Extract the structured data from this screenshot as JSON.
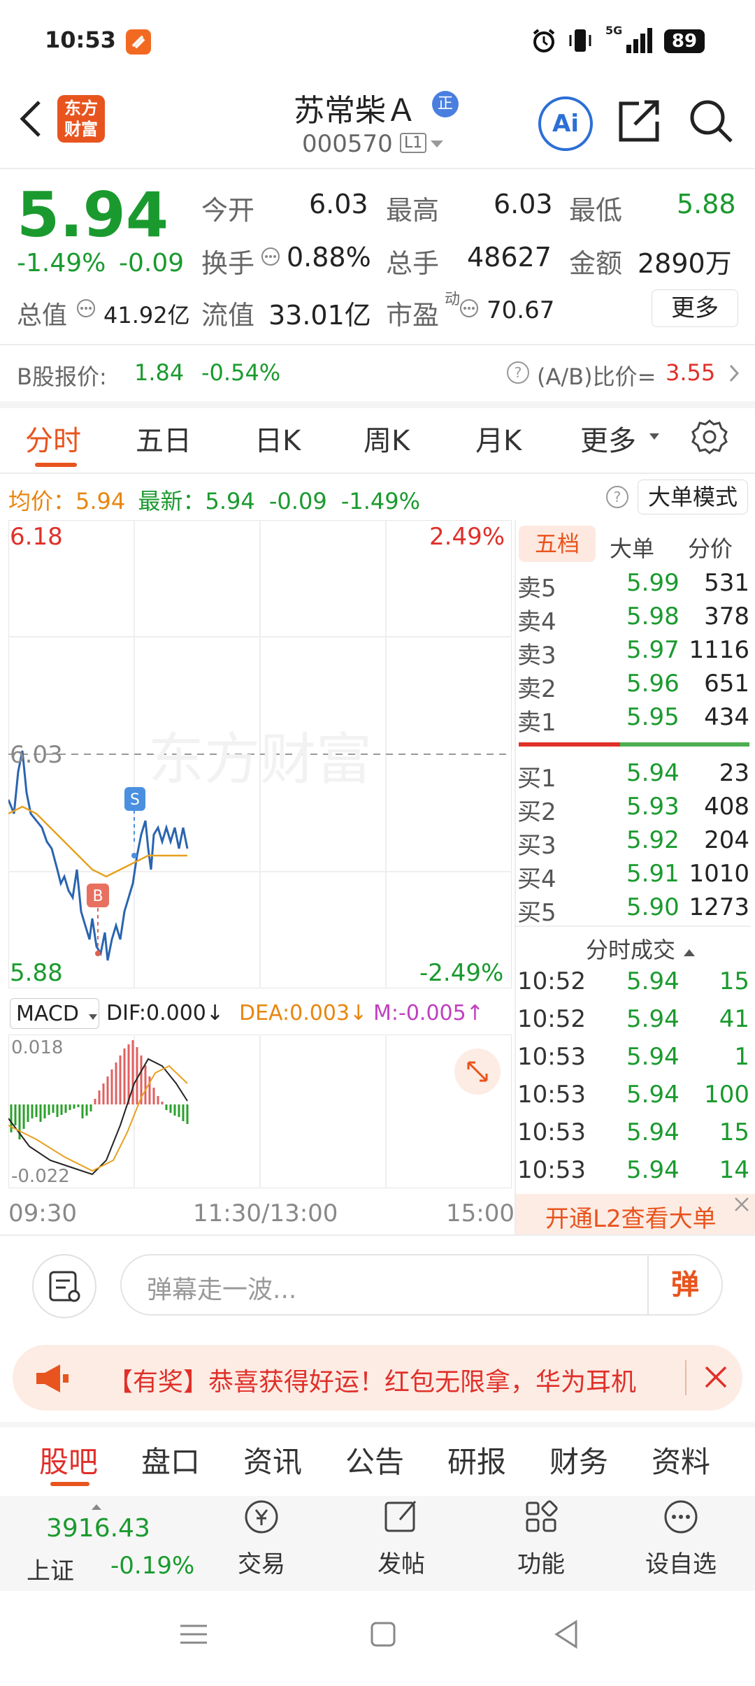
{
  "status_bar": {
    "time": "10:53",
    "network": "5G",
    "battery": "89"
  },
  "header": {
    "title": "苏常柴Ａ",
    "title_badge": "正",
    "code": "000570",
    "level_badge": "L1",
    "logo_text_top": "东方",
    "logo_text_bottom": "财富",
    "ai_label": "Ai"
  },
  "quote": {
    "price": "5.94",
    "change_pct": "-1.49%",
    "change": "-0.09",
    "open_label": "今开",
    "open": "6.03",
    "high_label": "最高",
    "high": "6.03",
    "low_label": "最低",
    "low": "5.88",
    "turnover_label": "换手",
    "turnover": "0.88%",
    "volume_label": "总手",
    "volume": "48627",
    "amount_label": "金额",
    "amount": "2890万",
    "mktcap_label": "总值",
    "mktcap": "41.92亿",
    "float_label": "流值",
    "float": "33.01亿",
    "pe_label": "市盈",
    "pe_sup": "动",
    "pe": "70.67",
    "more_label": "更多"
  },
  "b_share": {
    "label": "B股报价:",
    "price": "1.84",
    "change_pct": "-0.54%",
    "ratio_label": "(A/B)比价=",
    "ratio": "3.55"
  },
  "chart_tabs": [
    "分时",
    "五日",
    "日K",
    "周K",
    "月K",
    "更多"
  ],
  "avg_bar": {
    "avg_label": "均价：",
    "avg": "5.94",
    "latest_label": "最新：",
    "latest": "5.94",
    "change": "-0.09",
    "change_pct": "-1.49%",
    "big_mode": "大单模式"
  },
  "intraday": {
    "top_price": "6.18",
    "top_pct": "2.49%",
    "prev_close": "6.03",
    "bottom_price": "5.88",
    "bottom_pct": "-2.49%",
    "watermark": "东方财富",
    "marker_s": "S",
    "marker_b": "B"
  },
  "macd": {
    "selector": "MACD",
    "dif": "DIF:0.000↓",
    "dea": "DEA:0.003↓",
    "m": "M:-0.005↑",
    "top": "0.018",
    "bottom": "-0.022"
  },
  "time_axis": [
    "09:30",
    "11:30/13:00",
    "15:00"
  ],
  "orderbook": {
    "tabs": [
      "五档",
      "大单",
      "分价"
    ],
    "asks": [
      {
        "label": "卖5",
        "price": "5.99",
        "vol": "531"
      },
      {
        "label": "卖4",
        "price": "5.98",
        "vol": "378"
      },
      {
        "label": "卖3",
        "price": "5.97",
        "vol": "1116"
      },
      {
        "label": "卖2",
        "price": "5.96",
        "vol": "651"
      },
      {
        "label": "卖1",
        "price": "5.95",
        "vol": "434"
      }
    ],
    "bids": [
      {
        "label": "买1",
        "price": "5.94",
        "vol": "23"
      },
      {
        "label": "买2",
        "price": "5.93",
        "vol": "408"
      },
      {
        "label": "买3",
        "price": "5.92",
        "vol": "204"
      },
      {
        "label": "买4",
        "price": "5.91",
        "vol": "1010"
      },
      {
        "label": "买5",
        "price": "5.90",
        "vol": "1273"
      }
    ],
    "ask_share_pct": 44
  },
  "trades": {
    "title": "分时成交",
    "rows": [
      {
        "time": "10:52",
        "price": "5.94",
        "vol": "15"
      },
      {
        "time": "10:52",
        "price": "5.94",
        "vol": "41"
      },
      {
        "time": "10:53",
        "price": "5.94",
        "vol": "1"
      },
      {
        "time": "10:53",
        "price": "5.94",
        "vol": "100"
      },
      {
        "time": "10:53",
        "price": "5.94",
        "vol": "15"
      },
      {
        "time": "10:53",
        "price": "5.94",
        "vol": "14"
      }
    ],
    "l2_banner": "开通L2查看大单"
  },
  "comment": {
    "placeholder": "弹幕走一波...",
    "send_label": "弹"
  },
  "promo": {
    "text": "【有奖】恭喜获得好运！红包无限拿，华为耳机"
  },
  "bottom_tabs": [
    "股吧",
    "盘口",
    "资讯",
    "公告",
    "研报",
    "财务",
    "资料"
  ],
  "index": {
    "value": "3916.43",
    "name": "上证",
    "change_pct": "-0.19%"
  },
  "nav": [
    "交易",
    "发帖",
    "功能",
    "设自选"
  ],
  "colors": {
    "up": "#e0302a",
    "down": "#1a9a2e",
    "accent": "#e8541e",
    "avg_line": "#e8a020",
    "price_line": "#2a64b0"
  }
}
